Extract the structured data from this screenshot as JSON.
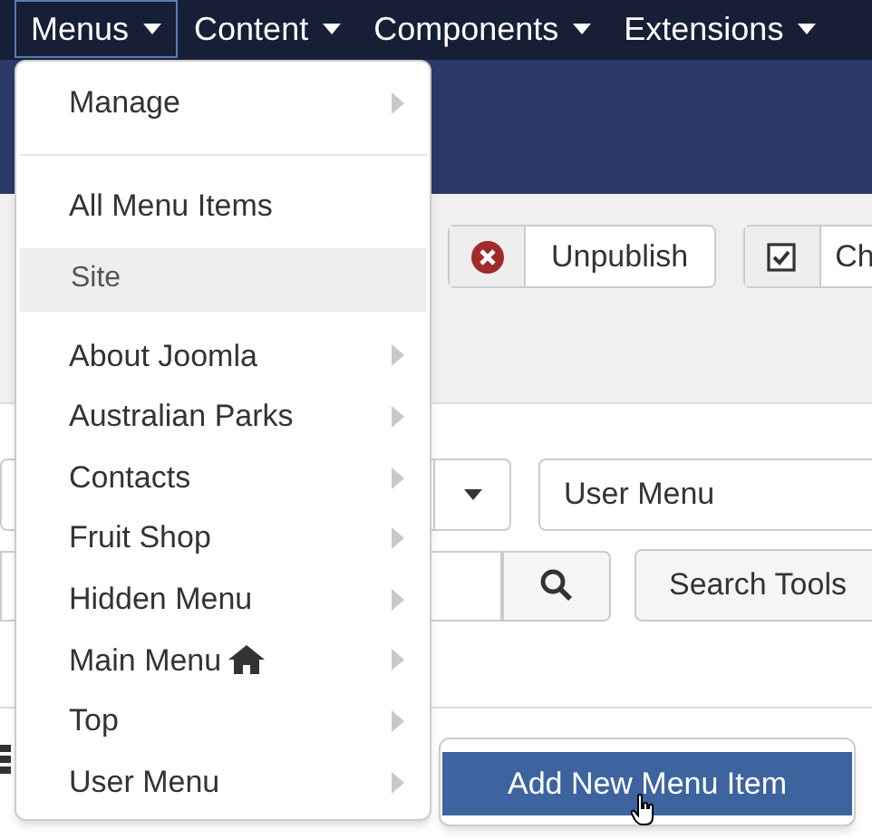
{
  "navbar": {
    "items": [
      {
        "label": "Menus",
        "selected": true
      },
      {
        "label": "Content",
        "selected": false
      },
      {
        "label": "Components",
        "selected": false
      },
      {
        "label": "Extensions",
        "selected": false
      }
    ]
  },
  "toolbar": {
    "buttons": [
      {
        "label": "Unpublish",
        "kind": "unpublish"
      },
      {
        "label": "Ch",
        "kind": "check"
      }
    ]
  },
  "filters": {
    "menu_select": "User Menu",
    "search_tools": "Search Tools"
  },
  "dropdown": {
    "items": [
      {
        "kind": "item",
        "label": "Manage",
        "submenu": true,
        "home": false
      },
      {
        "kind": "divider"
      },
      {
        "kind": "item",
        "label": "All Menu Items",
        "submenu": false,
        "home": false
      },
      {
        "kind": "header",
        "label": "Site"
      },
      {
        "kind": "item",
        "label": "About Joomla",
        "submenu": true,
        "home": false
      },
      {
        "kind": "item",
        "label": "Australian Parks",
        "submenu": true,
        "home": false
      },
      {
        "kind": "item",
        "label": "Contacts",
        "submenu": true,
        "home": false
      },
      {
        "kind": "item",
        "label": "Fruit Shop",
        "submenu": true,
        "home": false
      },
      {
        "kind": "item",
        "label": "Hidden Menu",
        "submenu": true,
        "home": false
      },
      {
        "kind": "item",
        "label": "Main Menu",
        "submenu": true,
        "home": true
      },
      {
        "kind": "item",
        "label": "Top",
        "submenu": true,
        "home": false
      },
      {
        "kind": "item",
        "label": "User Menu",
        "submenu": true,
        "home": false
      }
    ]
  },
  "submenu": {
    "items": [
      {
        "label": "Add New Menu Item",
        "selected": true
      }
    ]
  }
}
